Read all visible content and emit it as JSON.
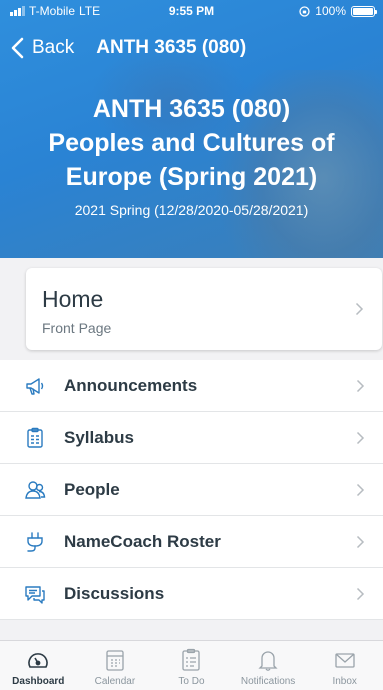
{
  "status_bar": {
    "carrier": "T-Mobile",
    "network": "LTE",
    "time": "9:55 PM",
    "battery": "100%",
    "battery_level": 1.0
  },
  "nav": {
    "back_label": "Back",
    "title": "ANTH 3635 (080)"
  },
  "course": {
    "title_line1": "ANTH 3635 (080)",
    "title_line2": "Peoples and Cultures of",
    "title_line3": "Europe (Spring 2021)",
    "term": "2021 Spring (12/28/2020-05/28/2021)"
  },
  "home": {
    "title": "Home",
    "subtitle": "Front Page"
  },
  "menu": [
    {
      "label": "Announcements",
      "icon": "megaphone-icon"
    },
    {
      "label": "Syllabus",
      "icon": "clipboard-icon"
    },
    {
      "label": "People",
      "icon": "people-icon"
    },
    {
      "label": "NameCoach Roster",
      "icon": "plug-icon"
    },
    {
      "label": "Discussions",
      "icon": "chat-icon"
    }
  ],
  "tabs": [
    {
      "label": "Dashboard",
      "icon": "dashboard-icon",
      "active": true
    },
    {
      "label": "Calendar",
      "icon": "calendar-icon",
      "active": false
    },
    {
      "label": "To Do",
      "icon": "todo-icon",
      "active": false
    },
    {
      "label": "Notifications",
      "icon": "bell-icon",
      "active": false
    },
    {
      "label": "Inbox",
      "icon": "mail-icon",
      "active": false
    }
  ],
  "colors": {
    "header": "#2f8fdd",
    "accent_icon": "#2a7bc0",
    "text": "#2d3b45",
    "muted": "#8b969e"
  }
}
